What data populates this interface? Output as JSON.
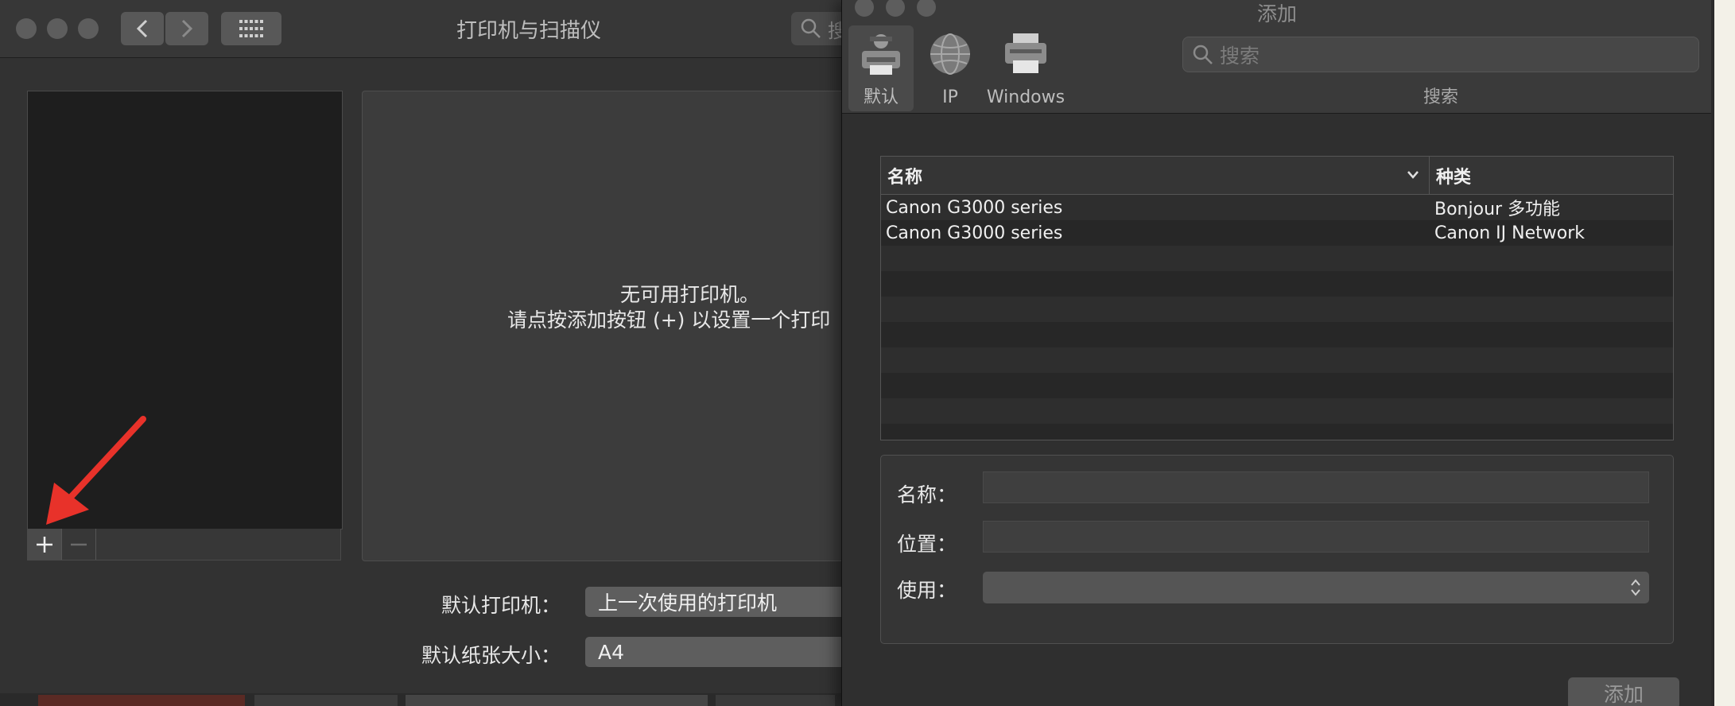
{
  "main_window": {
    "title": "打印机与扫描仪",
    "search_placeholder": "搜",
    "empty_state": {
      "line1": "无可用打印机。",
      "line2": "请点按添加按钮 (+) 以设置一个打印"
    },
    "default_printer_label": "默认打印机：",
    "default_printer_value": "上一次使用的打印机",
    "default_paper_label": "默认纸张大小：",
    "default_paper_value": "A4",
    "add_symbol": "+",
    "remove_symbol": "—"
  },
  "add_window": {
    "title": "添加",
    "toolbar": [
      {
        "label": "默认",
        "icon": "default-printer-icon"
      },
      {
        "label": "IP",
        "icon": "ip-globe-icon"
      },
      {
        "label": "Windows",
        "icon": "windows-printer-icon"
      }
    ],
    "search_placeholder": "搜索",
    "search_label": "搜索",
    "table": {
      "columns": [
        "名称",
        "种类"
      ],
      "rows": [
        {
          "name": "Canon G3000 series",
          "kind": "Bonjour 多功能"
        },
        {
          "name": "Canon G3000 series",
          "kind": "Canon IJ Network"
        }
      ]
    },
    "form": {
      "name_label": "名称：",
      "location_label": "位置：",
      "use_label": "使用："
    },
    "add_button": "添加"
  },
  "colors": {
    "annotation_arrow": "#e8322a"
  }
}
